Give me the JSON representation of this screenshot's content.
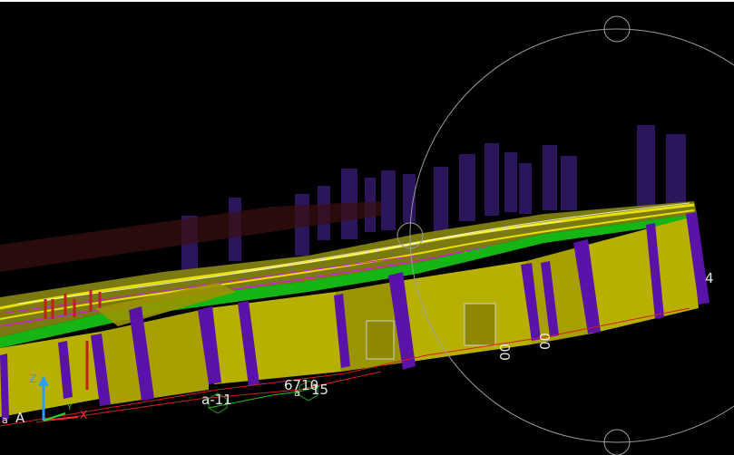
{
  "viewport": {
    "background": "#000000",
    "colors": {
      "wall": "#b8b000",
      "wall_dark": "#8e8800",
      "column": "#5a12a8",
      "slab": "#15b515",
      "mesh_yellow": "#e8e000",
      "mesh_magenta": "#d020d0",
      "rebar_red": "#c02020",
      "tower": "#3a1a6a",
      "view_circle": "#9a9a9a"
    },
    "view_cube_ring": "view-cube-ring"
  },
  "grid_labels": {
    "a11": "a-11",
    "g6710": "6710",
    "g15": "15",
    "small_a": "a",
    "left_a": "A",
    "left_small": "a",
    "g4": "4",
    "r00a": "00",
    "r00b": "00"
  },
  "ucs": {
    "z": "Z",
    "x": "X",
    "y": "Y",
    "z_color": "#2f9cff",
    "x_color": "#ff3030",
    "y_color": "#30d030"
  }
}
